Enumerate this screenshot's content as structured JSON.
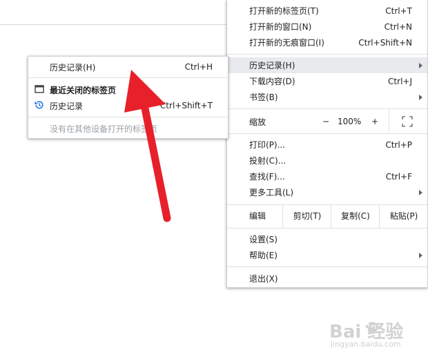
{
  "main_menu": {
    "items": [
      {
        "label": "打开新的标签页(T)",
        "shortcut": "Ctrl+T"
      },
      {
        "label": "打开新的窗口(N)",
        "shortcut": "Ctrl+N"
      },
      {
        "label": "打开新的无痕窗口(I)",
        "shortcut": "Ctrl+Shift+N"
      },
      {
        "label": "历史记录(H)",
        "shortcut": ""
      },
      {
        "label": "下载内容(D)",
        "shortcut": "Ctrl+J"
      },
      {
        "label": "书签(B)",
        "shortcut": ""
      },
      {
        "label": "打印(P)...",
        "shortcut": "Ctrl+P"
      },
      {
        "label": "投射(C)...",
        "shortcut": ""
      },
      {
        "label": "查找(F)...",
        "shortcut": "Ctrl+F"
      },
      {
        "label": "更多工具(L)",
        "shortcut": ""
      },
      {
        "label": "设置(S)",
        "shortcut": ""
      },
      {
        "label": "帮助(E)",
        "shortcut": ""
      },
      {
        "label": "退出(X)",
        "shortcut": ""
      }
    ],
    "zoom": {
      "label": "缩放",
      "minus": "−",
      "value": "100%",
      "plus": "+"
    },
    "edit": {
      "label": "编辑",
      "cut": "剪切(T)",
      "copy": "复制(C)",
      "paste": "粘贴(P)"
    }
  },
  "history_submenu": {
    "items": [
      {
        "label": "历史记录(H)",
        "shortcut": "Ctrl+H"
      },
      {
        "label": "最近关闭的标签页",
        "shortcut": ""
      },
      {
        "label": "历史记录",
        "shortcut": "Ctrl+Shift+T"
      },
      {
        "label": "没有在其他设备打开的标签页",
        "shortcut": ""
      }
    ]
  },
  "watermark": {
    "main": "Bai 经验",
    "sub": "jingyan.baidu.com"
  },
  "colors": {
    "arrow": "#e8202a",
    "highlight": "#e8eaed",
    "history_icon": "#1a73e8"
  }
}
